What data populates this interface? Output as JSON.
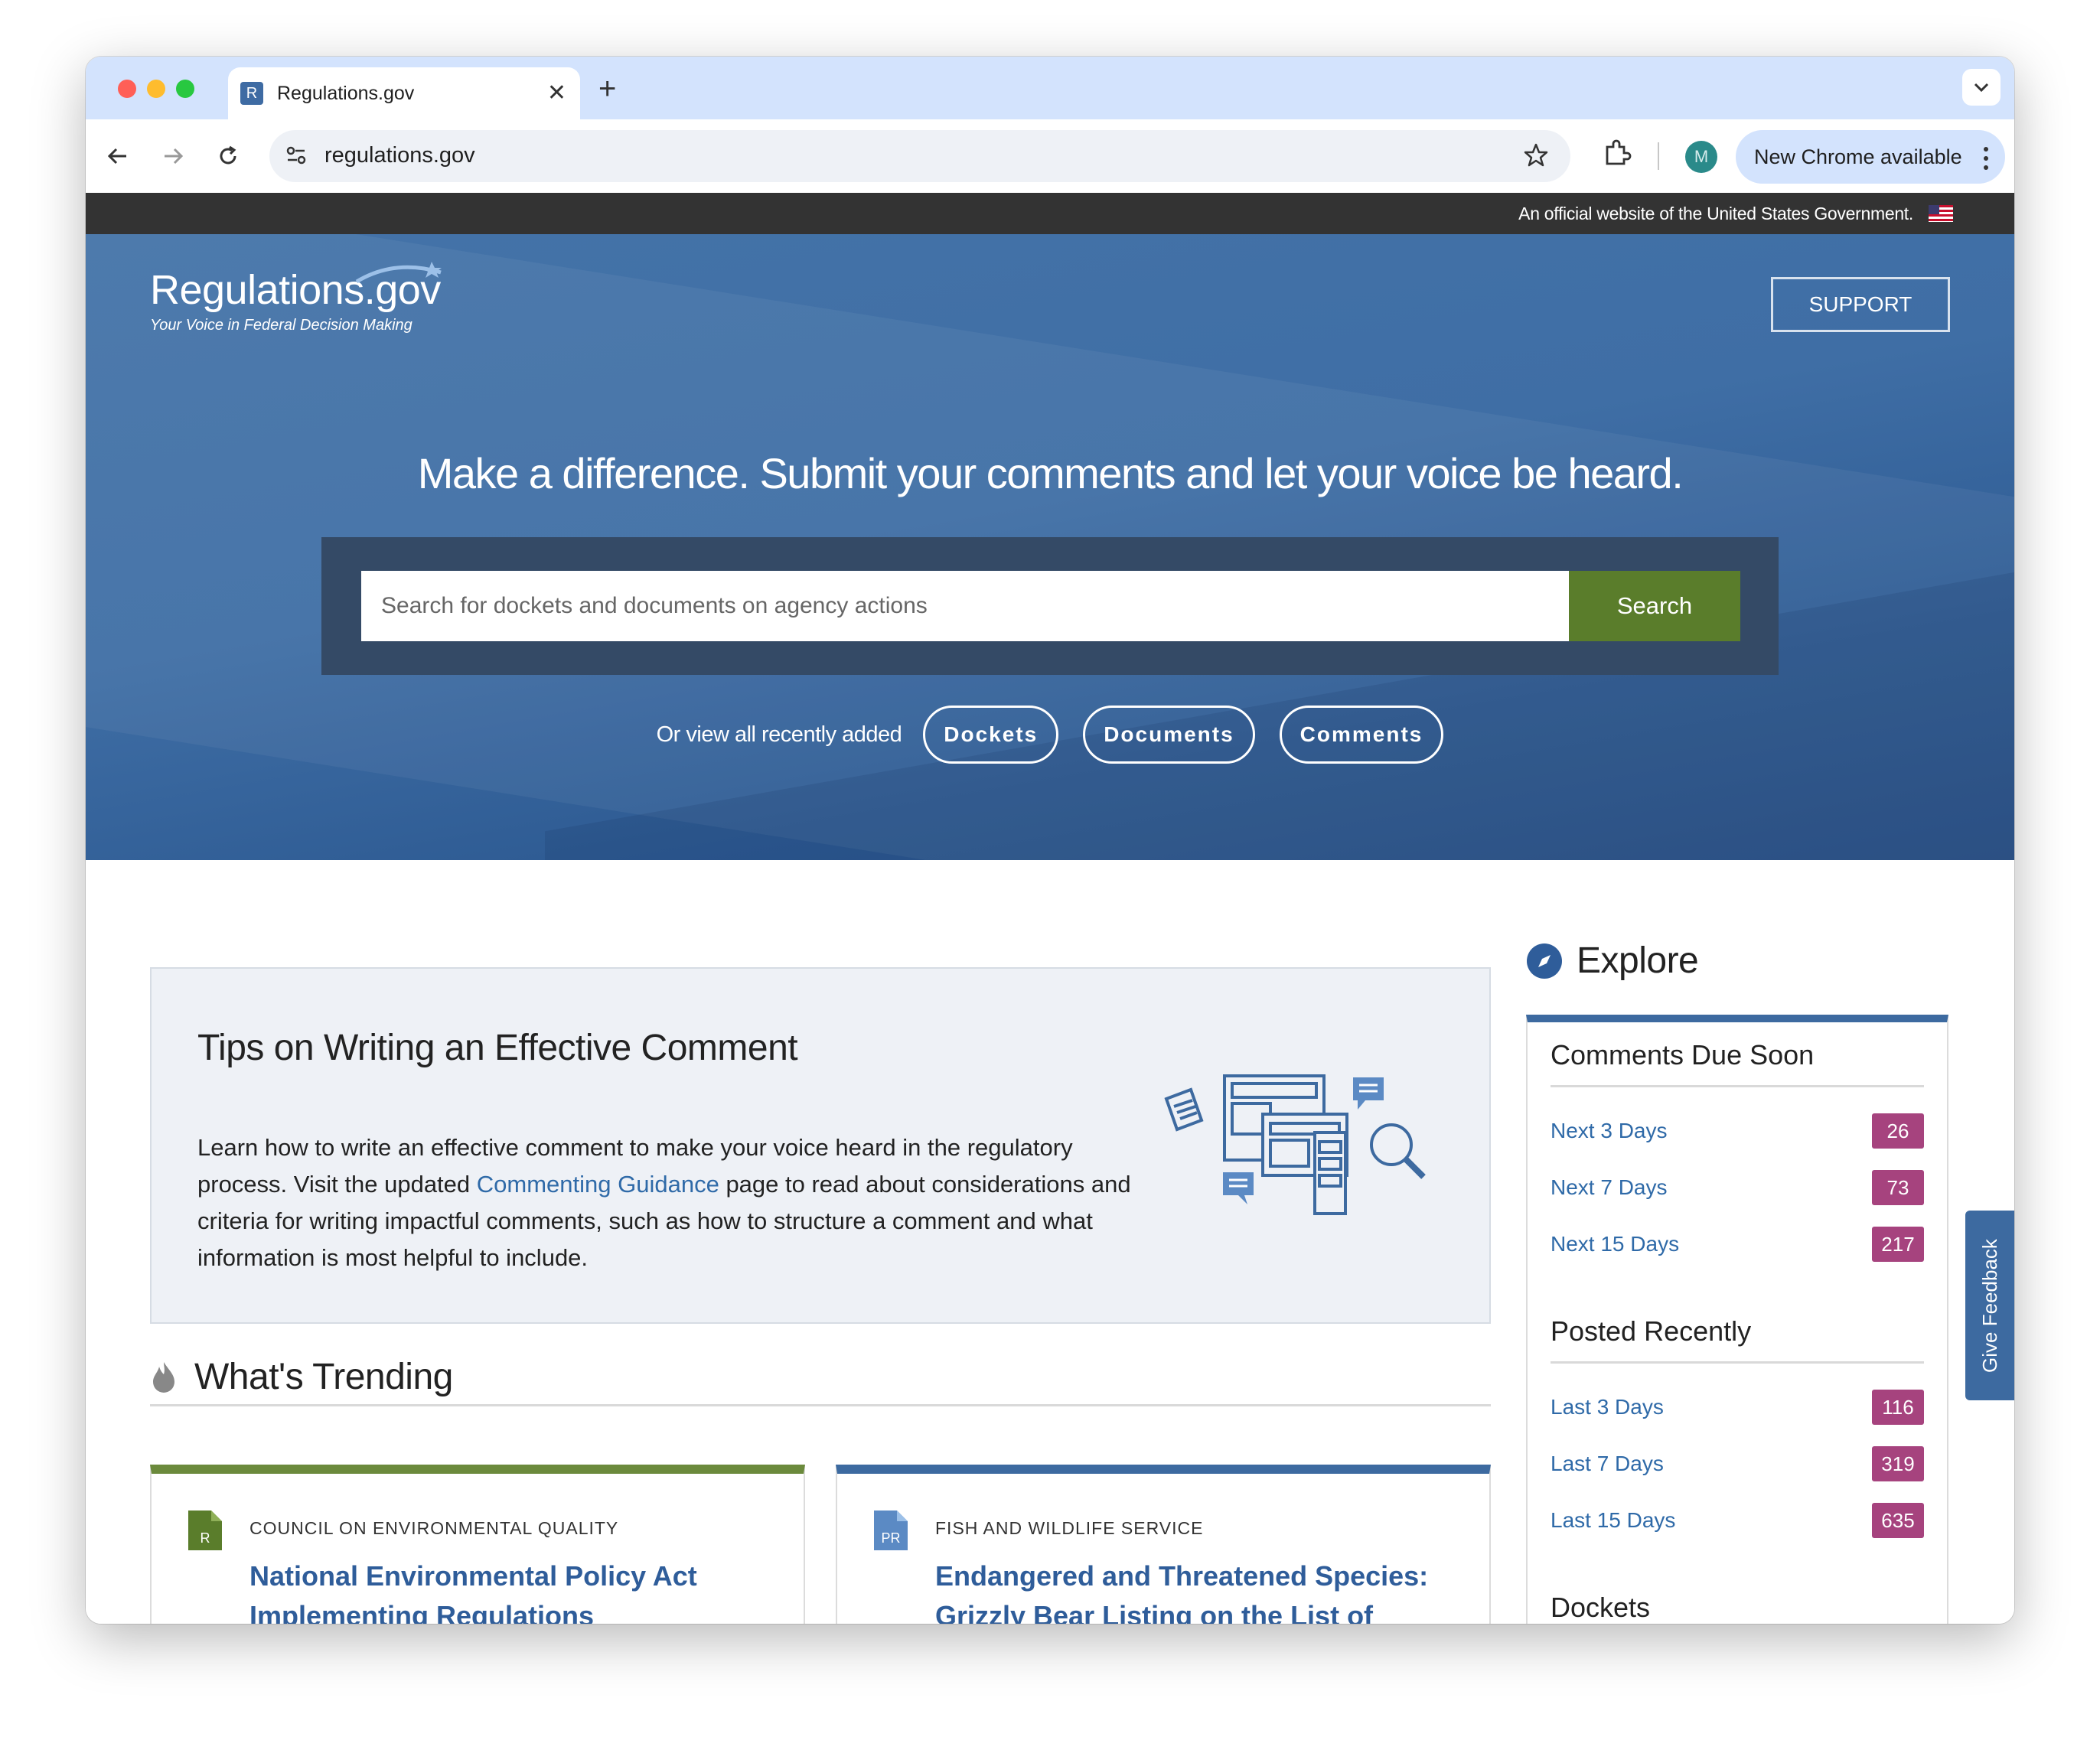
{
  "browser": {
    "tab_title": "Regulations.gov",
    "tab_favicon": "R",
    "url": "regulations.gov",
    "profile_initial": "M",
    "update_label": "New Chrome available"
  },
  "gov_banner": {
    "text": "An official website of the United States Government."
  },
  "header": {
    "logo": "Regulations.gov",
    "tagline": "Your Voice in Federal Decision Making",
    "support_label": "SUPPORT"
  },
  "hero": {
    "headline": "Make a difference. Submit your comments and let your voice be heard.",
    "search_placeholder": "Search for dockets and documents on agency actions",
    "search_button": "Search",
    "recent_label": "Or view all recently added",
    "recent_links": [
      "Dockets",
      "Documents",
      "Comments"
    ]
  },
  "tips": {
    "title": "Tips on Writing an Effective Comment",
    "body_before": "Learn how to write an effective comment to make your voice heard in the regulatory process. Visit the updated ",
    "link_text": "Commenting Guidance",
    "body_after": " page to read about considerations and criteria for writing impactful comments, such as how to structure a comment and what information is most helpful to include."
  },
  "trending": {
    "title": "What's Trending",
    "cards": [
      {
        "type_code": "R",
        "agency": "COUNCIL ON ENVIRONMENTAL QUALITY",
        "title": "National Environmental Policy Act Implementing Regulations",
        "accent": "#6b8a3c"
      },
      {
        "type_code": "PR",
        "agency": "FISH AND WILDLIFE SERVICE",
        "title": "Endangered and Threatened Species: Grizzly Bear Listing on the List of Endangered and Threatened …",
        "accent": "#3d6aa0"
      }
    ]
  },
  "explore": {
    "title": "Explore",
    "sections": [
      {
        "title": "Comments Due Soon",
        "items": [
          {
            "label": "Next 3 Days",
            "count": "26"
          },
          {
            "label": "Next 7 Days",
            "count": "73"
          },
          {
            "label": "Next 15 Days",
            "count": "217"
          }
        ]
      },
      {
        "title": "Posted Recently",
        "items": [
          {
            "label": "Last 3 Days",
            "count": "116"
          },
          {
            "label": "Last 7 Days",
            "count": "319"
          },
          {
            "label": "Last 15 Days",
            "count": "635"
          }
        ]
      },
      {
        "title": "Dockets",
        "items": []
      }
    ]
  },
  "feedback_label": "Give Feedback",
  "colors": {
    "hero": "#3f6ea5",
    "search_button": "#5a7d2b",
    "badge": "#a6437e",
    "link": "#2f6aa8"
  }
}
